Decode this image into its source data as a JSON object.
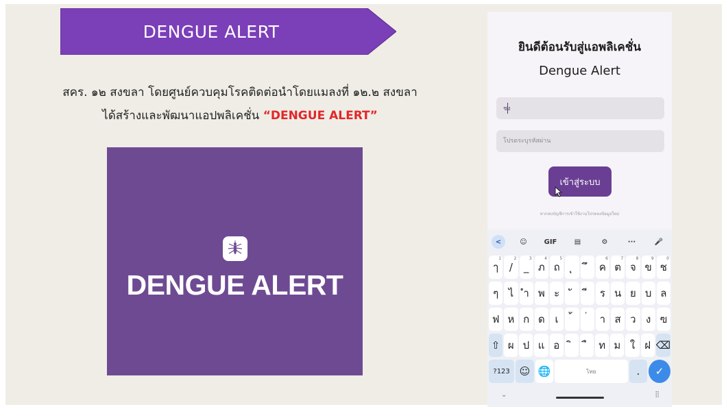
{
  "banner": {
    "title": "DENGUE ALERT",
    "color": "#7b3fb8"
  },
  "intro": {
    "line1": "สคร. ๑๒ สงขลา โดยศูนย์ควบคุมโรคติดต่อนำโดยแมลงที่ ๑๒.๒ สงขลา",
    "line2": "ได้สร้างและพัฒนาแอปพลิเคชั่น ",
    "highlight": "“DENGUE ALERT”",
    "highlight_color": "#e3262a"
  },
  "logo": {
    "text": "DENGUE ALERT",
    "background": "#6e4a93",
    "icon": "mosquito-icon"
  },
  "phone": {
    "welcome": "ยินดีต้อนรับสู่แอพลิเคชั่น",
    "app_name": "Dengue Alert",
    "username_value": "ชง",
    "password_placeholder": "โปรดระบุรหัสผ่าน",
    "login_label": "เข้าสู่ระบบ",
    "login_color": "#6a3f93",
    "hint": "หากลบบัญชีการเข้าใช้งานโปรดลงข้อมูลใหม่"
  },
  "keyboard": {
    "toolbar": [
      "<",
      "☺",
      "GIF",
      "▤",
      "⚙",
      "···",
      "🎤"
    ],
    "row1": [
      {
        "k": "ๅ",
        "n": "1"
      },
      {
        "k": "/",
        "n": "2"
      },
      {
        "k": "_",
        "n": "3"
      },
      {
        "k": "ภ",
        "n": "4"
      },
      {
        "k": "ถ",
        "n": "5"
      },
      {
        "k": "ุ",
        "n": ""
      },
      {
        "k": "ึ",
        "n": ""
      },
      {
        "k": "ค",
        "n": "6"
      },
      {
        "k": "ต",
        "n": "7"
      },
      {
        "k": "จ",
        "n": "8"
      },
      {
        "k": "ข",
        "n": "9"
      },
      {
        "k": "ช",
        "n": "0"
      }
    ],
    "row2": [
      "ๆ",
      "ไ",
      "ำ",
      "พ",
      "ะ",
      "ั",
      "ี",
      "ร",
      "น",
      "ย",
      "บ",
      "ล"
    ],
    "row3": [
      "ฟ",
      "ห",
      "ก",
      "ด",
      "เ",
      "้",
      "่",
      "า",
      "ส",
      "ว",
      "ง",
      "ฃ"
    ],
    "row4_shift": "⇧",
    "row4": [
      "ผ",
      "ป",
      "แ",
      "อ",
      "ิ",
      "ื",
      "ท",
      "ม",
      "ใ",
      "ฝ"
    ],
    "row4_backspace": "⌫",
    "row5": {
      "symbols": "?123",
      "emoji": "☺",
      "globe": "🌐",
      "space": "ไทย",
      "period": ".",
      "enter": "✓"
    },
    "nav": {
      "hide": "⌄",
      "grid": "⣿"
    }
  }
}
